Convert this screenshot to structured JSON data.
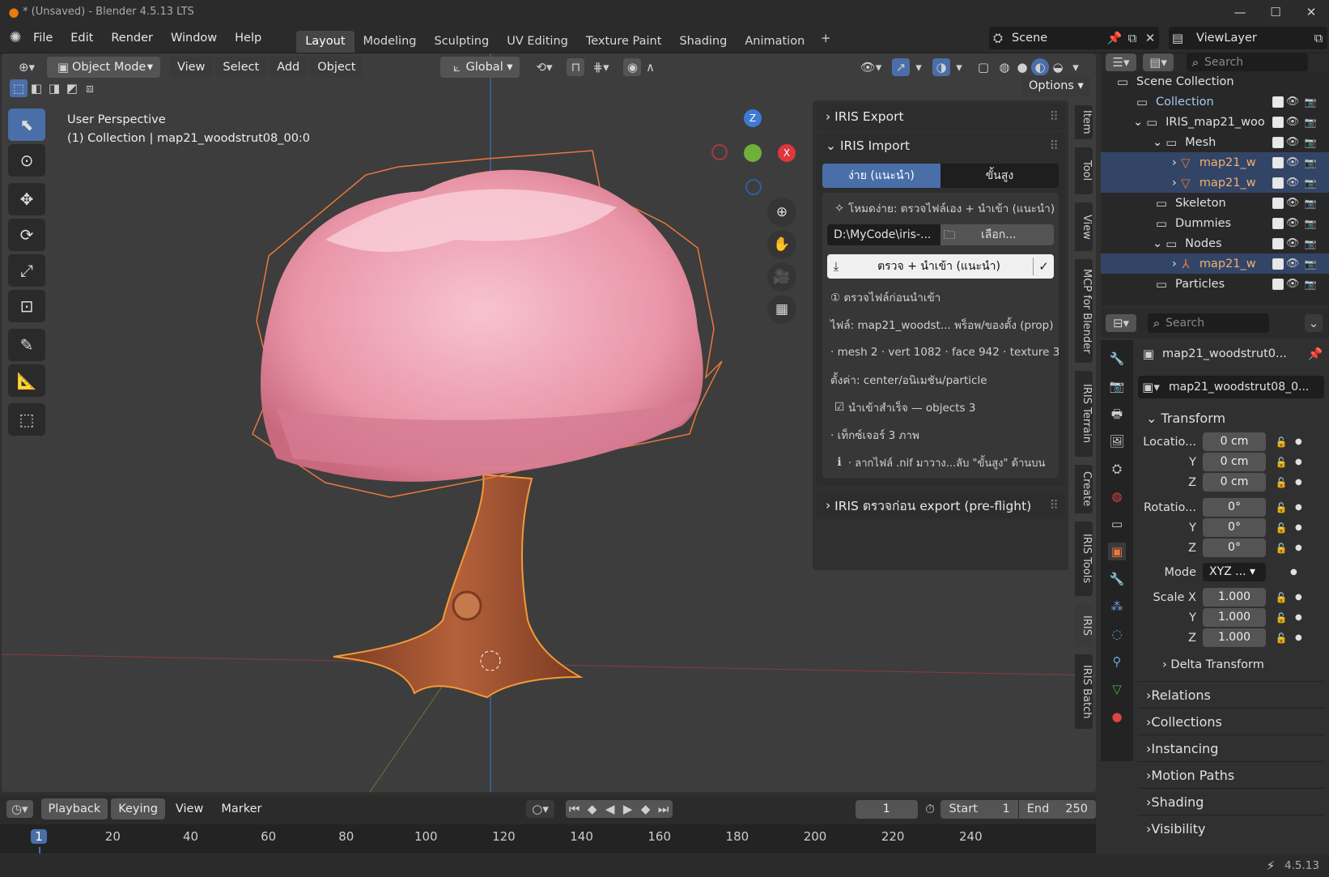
{
  "window": {
    "title": "* (Unsaved) - Blender 4.5.13 LTS"
  },
  "menu": [
    "File",
    "Edit",
    "Render",
    "Window",
    "Help"
  ],
  "workspaces": [
    "Layout",
    "Modeling",
    "Sculpting",
    "UV Editing",
    "Texture Paint",
    "Shading",
    "Animation"
  ],
  "scene": {
    "name": "Scene",
    "view_layer": "ViewLayer"
  },
  "viewport": {
    "mode": "Object Mode",
    "menus": [
      "View",
      "Select",
      "Add",
      "Object"
    ],
    "orientation": "Global",
    "options": "Options",
    "overlay_line1": "User Perspective",
    "overlay_line2": "(1) Collection | map21_woodstrut08_00:0",
    "gizmo": {
      "z": "Z",
      "x": "X"
    }
  },
  "npanel": {
    "export_title": "IRIS Export",
    "import_title": "IRIS Import",
    "tab_simple": "ง่าย (แนะนำ)",
    "tab_advanced": "ขั้นสูง",
    "mode_text": "โหมดง่าย: ตรวจไฟล์เอง + นำเข้า (แนะนำ)",
    "path": "D:\\MyCode\\iris-...",
    "browse": "เลือก...",
    "import_btn": "ตรวจ + นำเข้า (แนะนำ)",
    "step": "① ตรวจไฟล์ก่อนนำเข้า",
    "file_line": "ไฟล์: map21_woodst... พร็อพ/ของตั้ง (prop)",
    "stats": "· mesh 2 · vert 1082 · face 942 · texture 3",
    "settings": "ตั้งค่า: center/อนิเมชัน/particle",
    "success": "นำเข้าสำเร็จ — objects 3",
    "textures": "· เท็กซ์เจอร์ 3 ภาพ",
    "hint": "· ลากไฟล์ .nif มาวาง...ลับ \"ขั้นสูง\" ด้านบน",
    "preflight_title": "IRIS ตรวจก่อน export (pre-flight)"
  },
  "side_tabs": [
    "Item",
    "Tool",
    "View",
    "MCP for Blender",
    "IRIS Terrain",
    "Create",
    "IRIS Tools",
    "IRIS",
    "IRIS Batch"
  ],
  "outliner": {
    "search": "Search",
    "rows": [
      {
        "label": "Scene Collection",
        "indent": 0
      },
      {
        "label": "Collection",
        "indent": 1
      },
      {
        "label": "IRIS_map21_woo",
        "indent": 1
      },
      {
        "label": "Mesh",
        "indent": 2
      },
      {
        "label": "map21_w",
        "indent": 3
      },
      {
        "label": "map21_w",
        "indent": 3
      },
      {
        "label": "Skeleton",
        "indent": 2
      },
      {
        "label": "Dummies",
        "indent": 2
      },
      {
        "label": "Nodes",
        "indent": 2
      },
      {
        "label": "map21_w",
        "indent": 3
      },
      {
        "label": "Particles",
        "indent": 2
      }
    ]
  },
  "properties": {
    "search": "Search",
    "object_name": "map21_woodstrut0...",
    "data_name": "map21_woodstrut08_0...",
    "transform": "Transform",
    "location_label": "Locatio...",
    "rotation_label": "Rotatio...",
    "mode_label": "Mode",
    "mode_value": "XYZ ...",
    "scale_label": "Scale X",
    "y": "Y",
    "z": "Z",
    "loc": [
      "0 cm",
      "0 cm",
      "0 cm"
    ],
    "rot": [
      "0°",
      "0°",
      "0°"
    ],
    "scale": [
      "1.000",
      "1.000",
      "1.000"
    ],
    "delta": "Delta Transform",
    "sections": [
      "Relations",
      "Collections",
      "Instancing",
      "Motion Paths",
      "Shading",
      "Visibility"
    ]
  },
  "timeline": {
    "menus": [
      "Playback",
      "Keying",
      "View",
      "Marker"
    ],
    "current": "1",
    "start_label": "Start",
    "start": "1",
    "end_label": "End",
    "end": "250",
    "ticks": [
      "1",
      "20",
      "40",
      "60",
      "80",
      "100",
      "120",
      "140",
      "160",
      "180",
      "200",
      "220",
      "240"
    ]
  },
  "status": {
    "version": "4.5.13"
  },
  "colors": {
    "accent": "#4a6ea8",
    "selection_outline": "#e8793a",
    "foliage": "#f0a6b8",
    "trunk": "#a0522d"
  }
}
